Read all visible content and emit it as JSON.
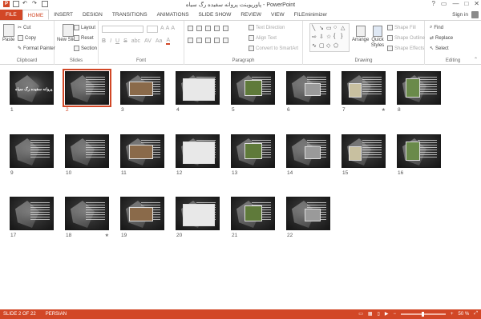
{
  "window": {
    "title": "پاورپوینت پروانه سفیده رگ سیاه - PowerPoint",
    "logo": "P",
    "controls": [
      "?",
      "▭",
      "—",
      "□",
      "✕"
    ]
  },
  "tabs": [
    "FILE",
    "HOME",
    "INSERT",
    "DESIGN",
    "TRANSITIONS",
    "ANIMATIONS",
    "SLIDE SHOW",
    "REVIEW",
    "VIEW",
    "FILEminimizer"
  ],
  "active_tab": "HOME",
  "signin": "Sign in",
  "ribbon": {
    "clipboard": {
      "label": "Clipboard",
      "paste": "Paste",
      "cut": "Cut",
      "copy": "Copy",
      "format_painter": "Format Painter"
    },
    "slides": {
      "label": "Slides",
      "new_slide": "New Slide",
      "layout": "Layout",
      "reset": "Reset",
      "section": "Section"
    },
    "font": {
      "label": "Font",
      "bold": "B",
      "italic": "I",
      "underline": "U",
      "strike": "S",
      "abc": "abc",
      "av": "AV",
      "aa": "Aa",
      "grow": "A",
      "shrink": "A",
      "clear": "A",
      "font_color": "A"
    },
    "paragraph": {
      "label": "Paragraph",
      "text_direction": "Text Direction",
      "align_text": "Align Text",
      "smartart": "Convert to SmartArt"
    },
    "drawing": {
      "label": "Drawing",
      "arrange": "Arrange",
      "quick_styles": "Quick Styles",
      "shape_fill": "Shape Fill",
      "shape_outline": "Shape Outline",
      "shape_effects": "Shape Effects"
    },
    "editing": {
      "label": "Editing",
      "find": "Find",
      "replace": "Replace",
      "select": "Select"
    }
  },
  "slides": [
    {
      "num": "1",
      "title": "پروانه سفیده رگ سیاه"
    },
    {
      "num": "2",
      "selected": true
    },
    {
      "num": "3"
    },
    {
      "num": "4"
    },
    {
      "num": "5"
    },
    {
      "num": "6"
    },
    {
      "num": "7",
      "star": "★"
    },
    {
      "num": "8"
    },
    {
      "num": "9"
    },
    {
      "num": "10"
    },
    {
      "num": "11"
    },
    {
      "num": "12"
    },
    {
      "num": "13"
    },
    {
      "num": "14"
    },
    {
      "num": "15"
    },
    {
      "num": "16"
    },
    {
      "num": "17"
    },
    {
      "num": "18",
      "star": "★"
    },
    {
      "num": "19"
    },
    {
      "num": "20"
    },
    {
      "num": "21"
    },
    {
      "num": "22"
    }
  ],
  "status": {
    "slide": "SLIDE 2 OF 22",
    "language": "PERSIAN",
    "zoom": "50 %",
    "minus": "−",
    "plus": "+"
  },
  "colors": {
    "accent": "#d24726"
  }
}
